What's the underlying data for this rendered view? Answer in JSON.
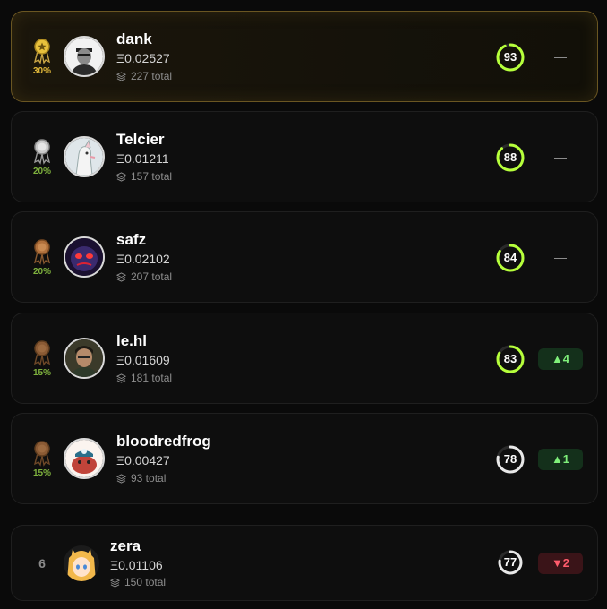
{
  "rows": [
    {
      "rank": 1,
      "medal": "gold-medal-icon",
      "payout": "30%",
      "avatar": "avatar-dank",
      "name": "dank",
      "eth": "Ξ0.02527",
      "total": "227 total",
      "score": "93",
      "score_fraction": 0.93,
      "change_type": "none",
      "change": ""
    },
    {
      "rank": 2,
      "medal": "silver-medal-icon",
      "payout": "20%",
      "avatar": "avatar-telcier",
      "name": "Telcier",
      "eth": "Ξ0.01211",
      "total": "157 total",
      "score": "88",
      "score_fraction": 0.88,
      "change_type": "none",
      "change": ""
    },
    {
      "rank": 3,
      "medal": "bronze-medal-icon",
      "payout": "20%",
      "avatar": "avatar-safz",
      "name": "safz",
      "eth": "Ξ0.02102",
      "total": "207 total",
      "score": "84",
      "score_fraction": 0.84,
      "change_type": "none",
      "change": ""
    },
    {
      "rank": 4,
      "medal": "bronze-medal-icon",
      "payout": "15%",
      "avatar": "avatar-lehl",
      "name": "le.hl",
      "eth": "Ξ0.01609",
      "total": "181 total",
      "score": "83",
      "score_fraction": 0.83,
      "change_type": "up",
      "change": "▲4"
    },
    {
      "rank": 5,
      "medal": "bronze-medal-icon",
      "payout": "15%",
      "avatar": "avatar-bloodredfrog",
      "name": "bloodredfrog",
      "eth": "Ξ0.00427",
      "total": "93 total",
      "score": "78",
      "score_fraction": 0.78,
      "change_type": "up",
      "change": "▲1"
    },
    {
      "rank": 6,
      "rank_label": "6",
      "avatar": "avatar-zera",
      "name": "zera",
      "eth": "Ξ0.01106",
      "total": "150 total",
      "score": "77",
      "score_fraction": 0.77,
      "change_type": "down",
      "change": "▼2"
    }
  ],
  "colors": {
    "gold": "#e0b83a",
    "payout_green": "#7fb23e",
    "score_high": "#b6ff3b",
    "score_mid": "#e8e8e8",
    "up": "#7ff07a",
    "down": "#ff5c6c"
  }
}
